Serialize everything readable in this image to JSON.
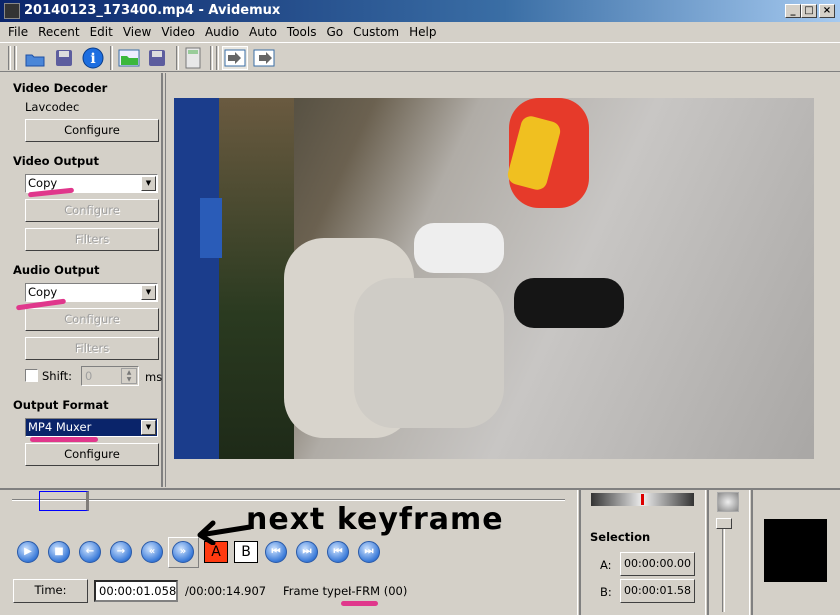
{
  "window": {
    "title": "20140123_173400.mp4 - Avidemux",
    "controls": [
      "_",
      "□",
      "×"
    ]
  },
  "menu": [
    "File",
    "Recent",
    "Edit",
    "View",
    "Video",
    "Audio",
    "Auto",
    "Tools",
    "Go",
    "Custom",
    "Help"
  ],
  "toolbar": [
    "open-icon",
    "save-icon",
    "info-icon",
    "open-folder-icon",
    "save-as-icon",
    "calculator-icon",
    "input-view-icon",
    "output-view-icon"
  ],
  "left": {
    "video_decoder": {
      "heading": "Video Decoder",
      "codec": "Lavcodec",
      "configure": "Configure"
    },
    "video_output": {
      "heading": "Video Output",
      "value": "Copy",
      "configure": "Configure",
      "filters": "Filters"
    },
    "audio_output": {
      "heading": "Audio Output",
      "value": "Copy",
      "configure": "Configure",
      "filters": "Filters",
      "shift_label": "Shift:",
      "shift_value": "0",
      "shift_unit": "ms",
      "shift_checked": false
    },
    "output_format": {
      "heading": "Output Format",
      "value": "MP4 Muxer",
      "configure": "Configure"
    }
  },
  "playback": {
    "buttons": [
      "play",
      "stop",
      "previous-frame",
      "next-frame",
      "previous-keyframe",
      "next-keyframe",
      "set-marker-a",
      "set-marker-b",
      "go-to-start",
      "go-to-marker-a",
      "go-to-marker-b",
      "go-to-end"
    ],
    "marker_a": "A",
    "marker_b": "B",
    "position_fraction": 0.071
  },
  "status": {
    "time_button": "Time:",
    "current_time": "00:00:01.058",
    "total_time": "/00:00:14.907",
    "frame_type_label": "Frame type:",
    "frame_type": "I-FRM (00)"
  },
  "selection": {
    "heading": "Selection",
    "a_label": "A:",
    "a_value": "00:00:00.00",
    "b_label": "B:",
    "b_value": "00:00:01.58"
  },
  "annotation": {
    "text": "next keyframe",
    "color": "#e0378c"
  }
}
